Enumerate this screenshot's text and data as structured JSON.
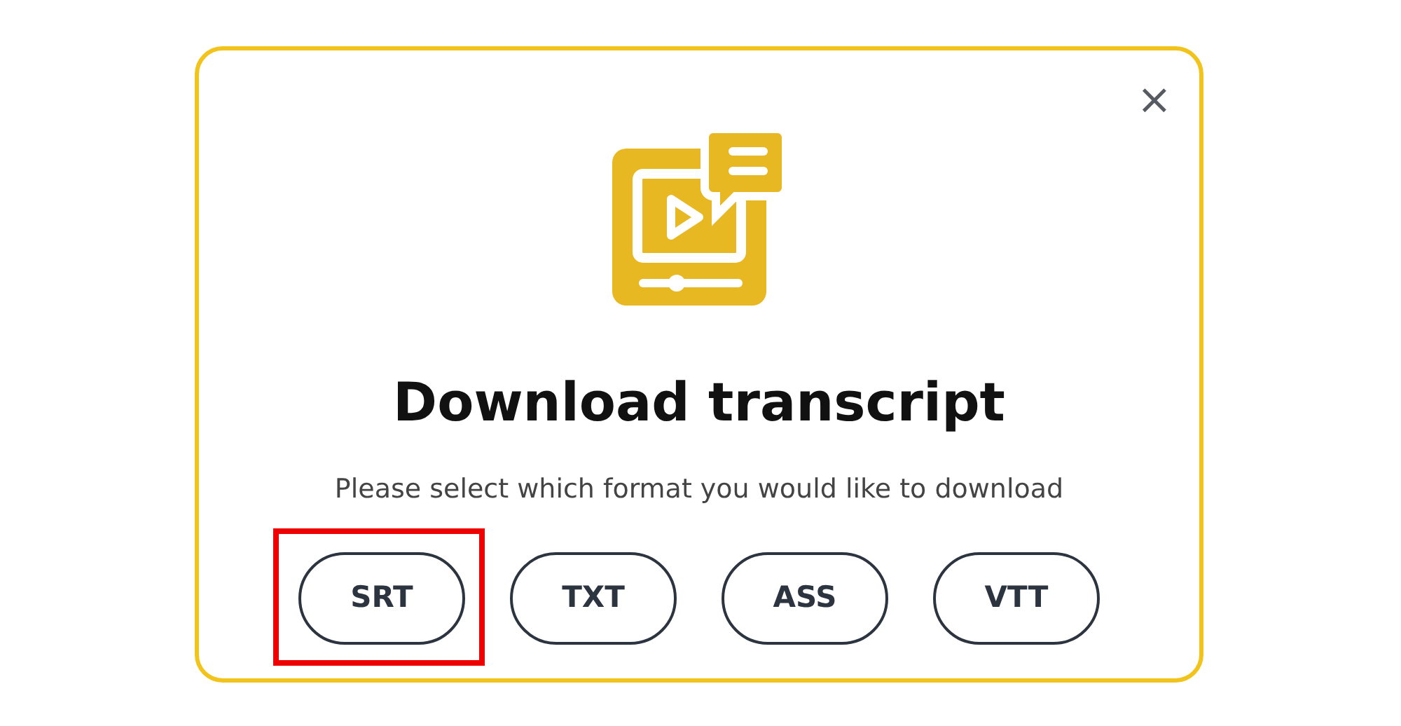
{
  "dialog": {
    "title": "Download transcript",
    "message": "Please select which format you would like to download",
    "close_label": "×",
    "formats": [
      {
        "label": "SRT",
        "highlighted": true
      },
      {
        "label": "TXT",
        "highlighted": false
      },
      {
        "label": "ASS",
        "highlighted": false
      },
      {
        "label": "VTT",
        "highlighted": false
      }
    ]
  }
}
